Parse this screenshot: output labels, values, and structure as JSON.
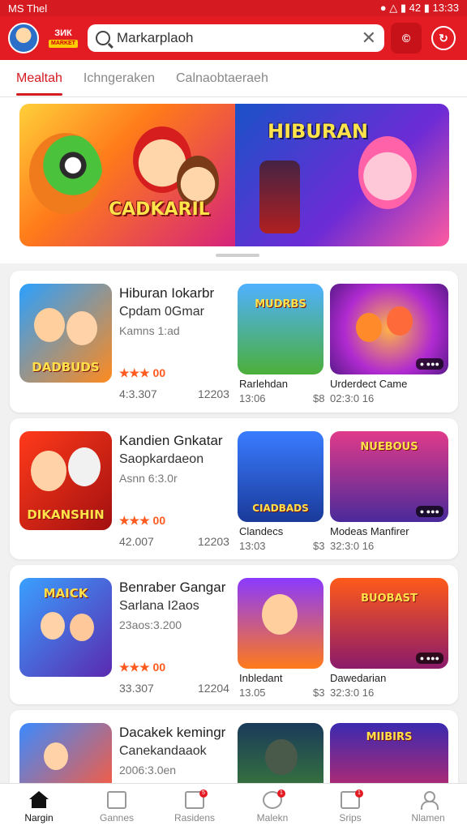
{
  "status_bar": {
    "left": "MS Thel",
    "right": "● △ ▮ 42 ▮ 13:33"
  },
  "header": {
    "brand": "âŒƒâˆ‰",
    "brand_text": "⨯¿ɣ",
    "search_placeholder": "Markarplaoh",
    "search_value": "Markarplaoh",
    "btn1": "©",
    "btn2": "◔"
  },
  "tabs": [
    {
      "label": "Mealtah"
    },
    {
      "label": "Ichngeraken"
    },
    {
      "label": "Calnaobtaeraeh"
    }
  ],
  "banner": {
    "left_title": "CADKARIL",
    "right_title": "HIBURAN"
  },
  "cards": [
    {
      "title": "Hiburan Iokarbr",
      "subtitle": "Cpdam 0Gmar",
      "meta": "Kamns 1:ad",
      "rating": "★★★ 00",
      "price": "4:3.307",
      "size": "12203",
      "thumb_label": "DADBUDS",
      "side": [
        {
          "name": "Rarlehdan",
          "price": "13:06",
          "size": "$8",
          "thumb_label": "MUDRBS"
        },
        {
          "name": "Urderdect Came",
          "price": "02:3:0 16",
          "size": "",
          "thumb_label": ""
        }
      ]
    },
    {
      "title": "Kandien Gnkatar",
      "subtitle": "Saopkardaeon",
      "meta": "Asnn 6:3.0r",
      "rating": "★★★ 00",
      "price": "42.007",
      "size": "12203",
      "thumb_label": "DIKANSHIN",
      "side": [
        {
          "name": "Clandecs",
          "price": "13:03",
          "size": "$3",
          "thumb_label": "CIADBADS"
        },
        {
          "name": "Modeas Manfirer",
          "price": "32:3:0 16",
          "size": "",
          "thumb_label": "NUEBOUS"
        }
      ]
    },
    {
      "title": "Benraber Gangar",
      "subtitle": "Sarlana I2aos",
      "meta": "23aos:3.200",
      "rating": "★★★ 00",
      "price": "33.307",
      "size": "12204",
      "thumb_label": "MAICK",
      "side": [
        {
          "name": "Inbledant",
          "price": "13.05",
          "size": "$3",
          "thumb_label": ""
        },
        {
          "name": "Dawedarian",
          "price": "32:3:0 16",
          "size": "",
          "thumb_label": "BUOBAST"
        }
      ]
    },
    {
      "title": "Dacakek kemingr",
      "subtitle": "Canekandaaok",
      "meta": "2006:3.0en",
      "rating": "",
      "price": "",
      "size": "",
      "thumb_label": "",
      "side": [
        {
          "name": "",
          "price": "",
          "size": "",
          "thumb_label": ""
        },
        {
          "name": "",
          "price": "",
          "size": "",
          "thumb_label": "MIIBIRS"
        }
      ]
    }
  ],
  "bottom_nav": [
    {
      "label": "Nargin",
      "badge": ""
    },
    {
      "label": "Gannes",
      "badge": ""
    },
    {
      "label": "Rasidens",
      "badge": "5"
    },
    {
      "label": "Malekn",
      "badge": "1"
    },
    {
      "label": "Srips",
      "badge": "1"
    },
    {
      "label": "Nlamen",
      "badge": ""
    }
  ],
  "colors": {
    "brand_red": "#e31b23",
    "star_orange": "#ff5a1f"
  }
}
